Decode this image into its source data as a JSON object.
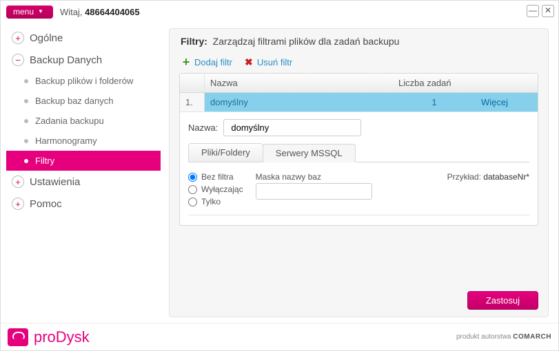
{
  "top": {
    "menu": "menu",
    "welcome_prefix": "Witaj,",
    "welcome_user": "48664404065"
  },
  "sidebar": {
    "items": [
      {
        "label": "Ogólne",
        "expanded": false
      },
      {
        "label": "Backup Danych",
        "expanded": true,
        "children": [
          {
            "label": "Backup plików i folderów"
          },
          {
            "label": "Backup baz danych"
          },
          {
            "label": "Zadania backupu"
          },
          {
            "label": "Harmonogramy"
          },
          {
            "label": "Filtry",
            "active": true
          }
        ]
      },
      {
        "label": "Ustawienia",
        "expanded": false
      },
      {
        "label": "Pomoc",
        "expanded": false
      }
    ]
  },
  "panel": {
    "title_label": "Filtry:",
    "title_desc": "Zarządzaj filtrami plików dla zadań backupu",
    "toolbar": {
      "add": "Dodaj filtr",
      "del": "Usuń filtr"
    },
    "columns": {
      "name": "Nazwa",
      "count": "Liczba zadań"
    },
    "rows": [
      {
        "idx": "1.",
        "name": "domyślny",
        "count": "1",
        "more": "Więcej"
      }
    ],
    "detail": {
      "name_label": "Nazwa:",
      "name_value": "domyślny",
      "tabs": [
        {
          "label": "Pliki/Foldery",
          "active": false
        },
        {
          "label": "Serwery MSSQL",
          "active": true
        }
      ],
      "radios": [
        {
          "label": "Bez filtra",
          "checked": true
        },
        {
          "label": "Wyłączając",
          "checked": false
        },
        {
          "label": "Tylko",
          "checked": false
        }
      ],
      "mask_label": "Maska nazwy baz",
      "mask_value": "",
      "example_label": "Przykład:",
      "example_value": "databaseNr*"
    },
    "apply": "Zastosuj"
  },
  "footer": {
    "brand": "proDysk",
    "attr_prefix": "produkt autorstwa",
    "attr_brand": "COMARCH"
  }
}
